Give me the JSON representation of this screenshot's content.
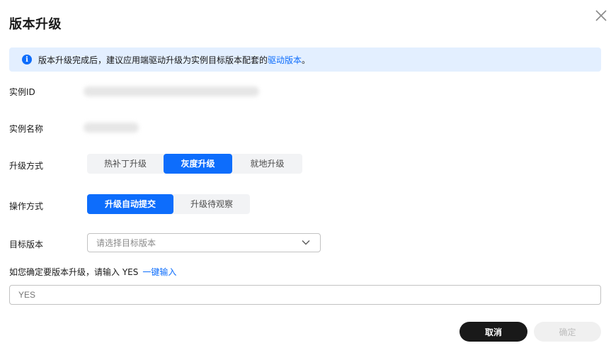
{
  "dialog": {
    "title": "版本升级",
    "close_icon": "close-icon"
  },
  "notice": {
    "icon": "info-icon",
    "icon_glyph": "i",
    "text": "版本升级完成后，建议应用端驱动升级为实例目标版本配套的",
    "link": "驱动版本",
    "suffix": "。"
  },
  "fields": {
    "instance_id_label": "实例ID",
    "instance_name_label": "实例名称",
    "upgrade_mode_label": "升级方式",
    "operation_mode_label": "操作方式",
    "target_version_label": "目标版本"
  },
  "upgrade_modes": {
    "options": [
      "热补丁升级",
      "灰度升级",
      "就地升级"
    ],
    "selected": "灰度升级"
  },
  "operation_modes": {
    "options": [
      "升级自动提交",
      "升级待观察"
    ],
    "selected": "升级自动提交"
  },
  "target_version": {
    "placeholder": "请选择目标版本"
  },
  "confirm": {
    "text": "如您确定要版本升级，请输入 YES",
    "link": "一键输入",
    "input_placeholder": "YES"
  },
  "footer": {
    "cancel": "取消",
    "ok": "确定"
  },
  "colors": {
    "accent": "#0d6dfc",
    "notice_bg": "#e3efff",
    "cancel_bg": "#191919",
    "disabled_bg": "#f0f0f0"
  }
}
